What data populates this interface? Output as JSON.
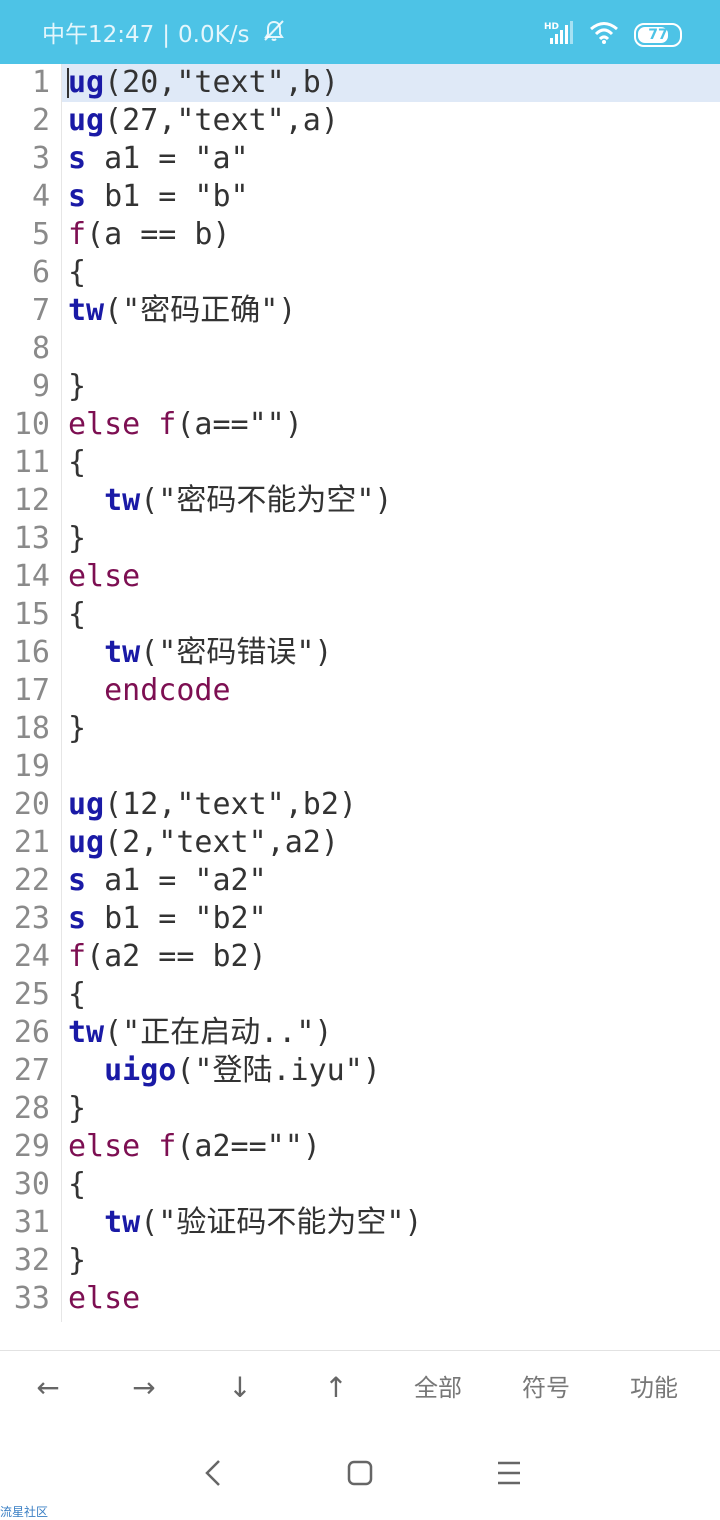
{
  "status_bar": {
    "time": "中午12:47",
    "separator": "|",
    "net_speed": "0.0K/s",
    "mute_icon": "bell-off-icon",
    "signal_label": "HD",
    "battery": "77",
    "battery_level": 0.77
  },
  "editor": {
    "current_line": 1,
    "lines": [
      {
        "n": "1",
        "segments": [
          {
            "t": "ug",
            "c": "kw-blue"
          },
          {
            "t": "(20,\"text\",b)"
          }
        ]
      },
      {
        "n": "2",
        "segments": [
          {
            "t": "ug",
            "c": "kw-blue"
          },
          {
            "t": "(27,\"text\",a)"
          }
        ]
      },
      {
        "n": "3",
        "segments": [
          {
            "t": "s",
            "c": "kw-blue"
          },
          {
            "t": " a1 = \"a\""
          }
        ]
      },
      {
        "n": "4",
        "segments": [
          {
            "t": "s",
            "c": "kw-blue"
          },
          {
            "t": " b1 = \"b\""
          }
        ]
      },
      {
        "n": "5",
        "segments": [
          {
            "t": "f",
            "c": "kw-purple"
          },
          {
            "t": "(a == b)"
          }
        ]
      },
      {
        "n": "6",
        "segments": [
          {
            "t": "{"
          }
        ]
      },
      {
        "n": "7",
        "segments": [
          {
            "t": "tw",
            "c": "kw-blue"
          },
          {
            "t": "(\"密码正确\")"
          }
        ]
      },
      {
        "n": "8",
        "segments": []
      },
      {
        "n": "9",
        "segments": [
          {
            "t": "}"
          }
        ]
      },
      {
        "n": "10",
        "segments": [
          {
            "t": "else f",
            "c": "kw-purple"
          },
          {
            "t": "(a==\"\")"
          }
        ]
      },
      {
        "n": "11",
        "segments": [
          {
            "t": "{"
          }
        ]
      },
      {
        "n": "12",
        "segments": [
          {
            "t": "  "
          },
          {
            "t": "tw",
            "c": "kw-blue"
          },
          {
            "t": "(\"密码不能为空\")"
          }
        ]
      },
      {
        "n": "13",
        "segments": [
          {
            "t": "}"
          }
        ]
      },
      {
        "n": "14",
        "segments": [
          {
            "t": "else",
            "c": "kw-purple"
          }
        ]
      },
      {
        "n": "15",
        "segments": [
          {
            "t": "{"
          }
        ]
      },
      {
        "n": "16",
        "segments": [
          {
            "t": "  "
          },
          {
            "t": "tw",
            "c": "kw-blue"
          },
          {
            "t": "(\"密码错误\")"
          }
        ]
      },
      {
        "n": "17",
        "segments": [
          {
            "t": "  "
          },
          {
            "t": "endcode",
            "c": "kw-purple"
          }
        ]
      },
      {
        "n": "18",
        "segments": [
          {
            "t": "}"
          }
        ]
      },
      {
        "n": "19",
        "segments": []
      },
      {
        "n": "20",
        "segments": [
          {
            "t": "ug",
            "c": "kw-blue"
          },
          {
            "t": "(12,\"text\",b2)"
          }
        ]
      },
      {
        "n": "21",
        "segments": [
          {
            "t": "ug",
            "c": "kw-blue"
          },
          {
            "t": "(2,\"text\",a2)"
          }
        ]
      },
      {
        "n": "22",
        "segments": [
          {
            "t": "s",
            "c": "kw-blue"
          },
          {
            "t": " a1 = \"a2\""
          }
        ]
      },
      {
        "n": "23",
        "segments": [
          {
            "t": "s",
            "c": "kw-blue"
          },
          {
            "t": " b1 = \"b2\""
          }
        ]
      },
      {
        "n": "24",
        "segments": [
          {
            "t": "f",
            "c": "kw-purple"
          },
          {
            "t": "(a2 == b2)"
          }
        ]
      },
      {
        "n": "25",
        "segments": [
          {
            "t": "{"
          }
        ]
      },
      {
        "n": "26",
        "segments": [
          {
            "t": "tw",
            "c": "kw-blue"
          },
          {
            "t": "(\"正在启动..\")"
          }
        ]
      },
      {
        "n": "27",
        "segments": [
          {
            "t": "  "
          },
          {
            "t": "uigo",
            "c": "kw-blue"
          },
          {
            "t": "(\"登陆.iyu\")"
          }
        ]
      },
      {
        "n": "28",
        "segments": [
          {
            "t": "}"
          }
        ]
      },
      {
        "n": "29",
        "segments": [
          {
            "t": "else f",
            "c": "kw-purple"
          },
          {
            "t": "(a2==\"\")"
          }
        ]
      },
      {
        "n": "30",
        "segments": [
          {
            "t": "{"
          }
        ]
      },
      {
        "n": "31",
        "segments": [
          {
            "t": "  "
          },
          {
            "t": "tw",
            "c": "kw-blue"
          },
          {
            "t": "(\"验证码不能为空\")"
          }
        ]
      },
      {
        "n": "32",
        "segments": [
          {
            "t": "}"
          }
        ]
      },
      {
        "n": "33",
        "segments": [
          {
            "t": "else",
            "c": "kw-purple"
          }
        ]
      }
    ]
  },
  "toolbar": {
    "left_arrow": "←",
    "right_arrow": "→",
    "down_arrow": "↓",
    "up_arrow": "↑",
    "all_label": "全部",
    "symbols_label": "符号",
    "functions_label": "功能"
  },
  "navbar": {
    "back_icon": "back-chevron-icon",
    "home_icon": "home-square-icon",
    "menu_icon": "menu-lines-icon"
  },
  "watermark": "流星社区",
  "colors": {
    "status_bar": "#4dc3e6",
    "keyword_blue": "#1a1aa6",
    "keyword_purple": "#7d0f52",
    "current_line": "#dfe9f7"
  }
}
